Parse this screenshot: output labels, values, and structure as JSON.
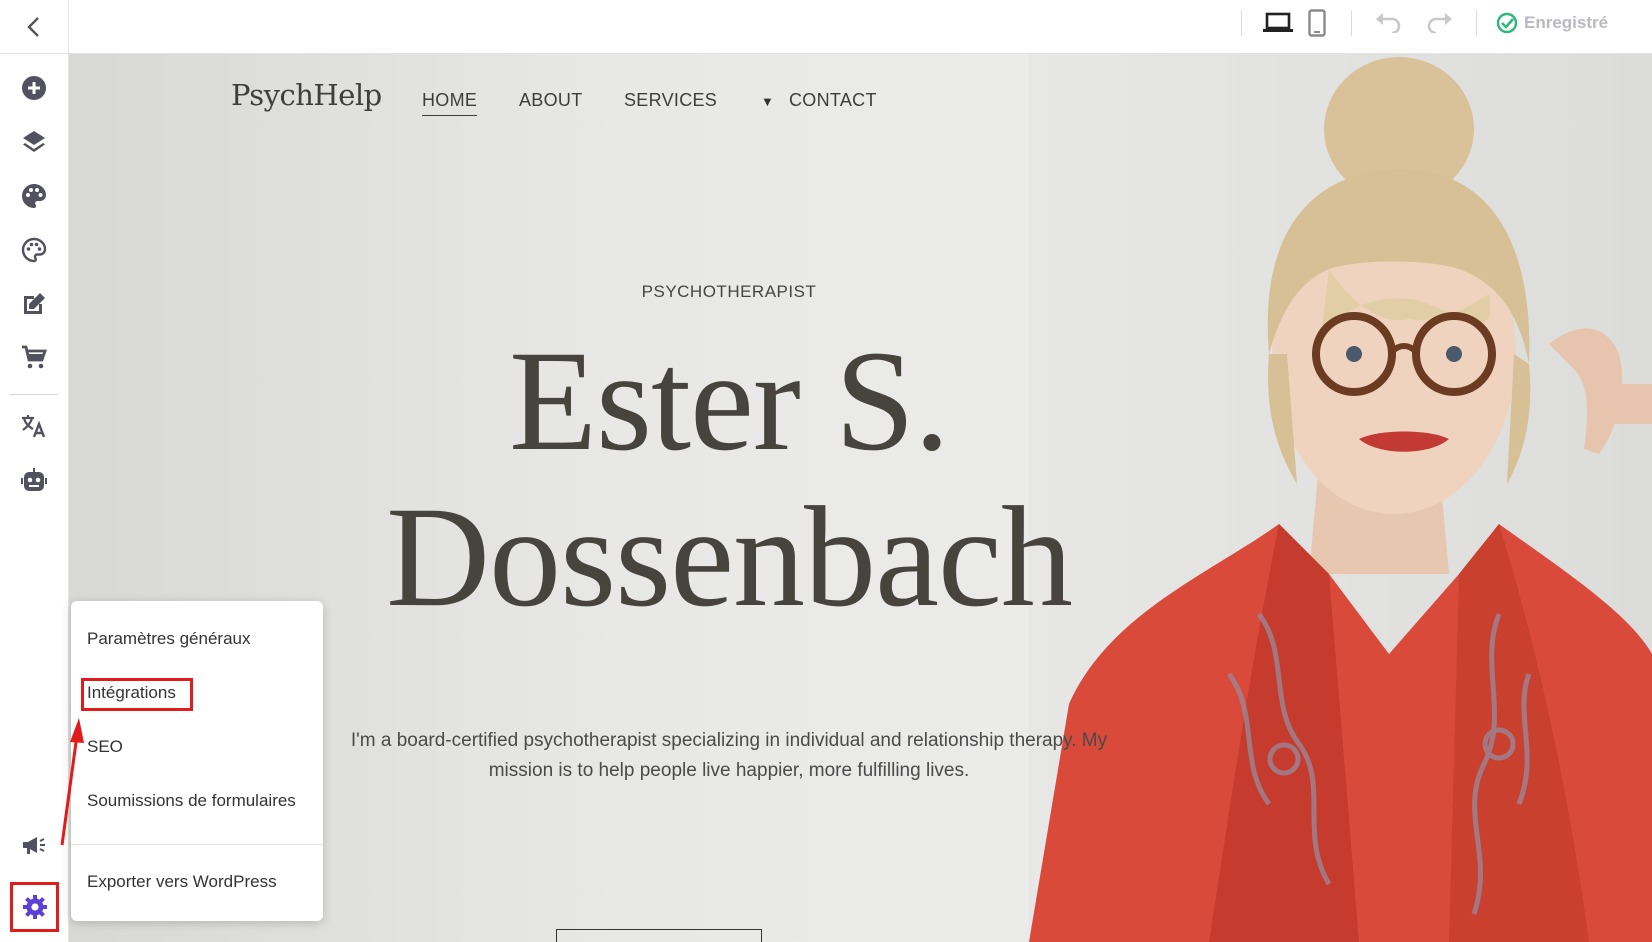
{
  "topbar": {
    "back_icon": "chevron-left-icon",
    "desktop_icon": "laptop-icon",
    "mobile_icon": "phone-icon",
    "undo_icon": "undo-icon",
    "redo_icon": "redo-icon",
    "saved_label": "Enregistré",
    "saved_color": "#2fb67c"
  },
  "sidebar": {
    "items": [
      {
        "icon": "add-circle-icon"
      },
      {
        "icon": "layers-icon"
      },
      {
        "icon": "palette-filled-icon"
      },
      {
        "icon": "palette-outline-icon"
      },
      {
        "icon": "edit-icon"
      },
      {
        "icon": "cart-icon"
      },
      {
        "icon": "translate-icon"
      },
      {
        "icon": "robot-icon"
      },
      {
        "icon": "megaphone-icon"
      },
      {
        "icon": "gear-icon"
      }
    ],
    "accent": "#5b3fd6"
  },
  "site": {
    "logo": "PsychHelp",
    "nav": [
      "HOME",
      "ABOUT",
      "SERVICES",
      "CONTACT"
    ],
    "kicker": "PSYCHOTHERAPIST",
    "headline_line1": "Ester S.",
    "headline_line2": "Dossenbach",
    "bio": "I'm a board-certified psychotherapist specializing in individual and relationship therapy. My mission is to help people live happier, more fulfilling lives."
  },
  "settings_menu": {
    "items": [
      "Paramètres généraux",
      "Intégrations",
      "SEO",
      "Soumissions de formulaires",
      "Exporter vers WordPress"
    ],
    "highlighted": "Intégrations"
  },
  "highlight_color": "#e21b1b"
}
